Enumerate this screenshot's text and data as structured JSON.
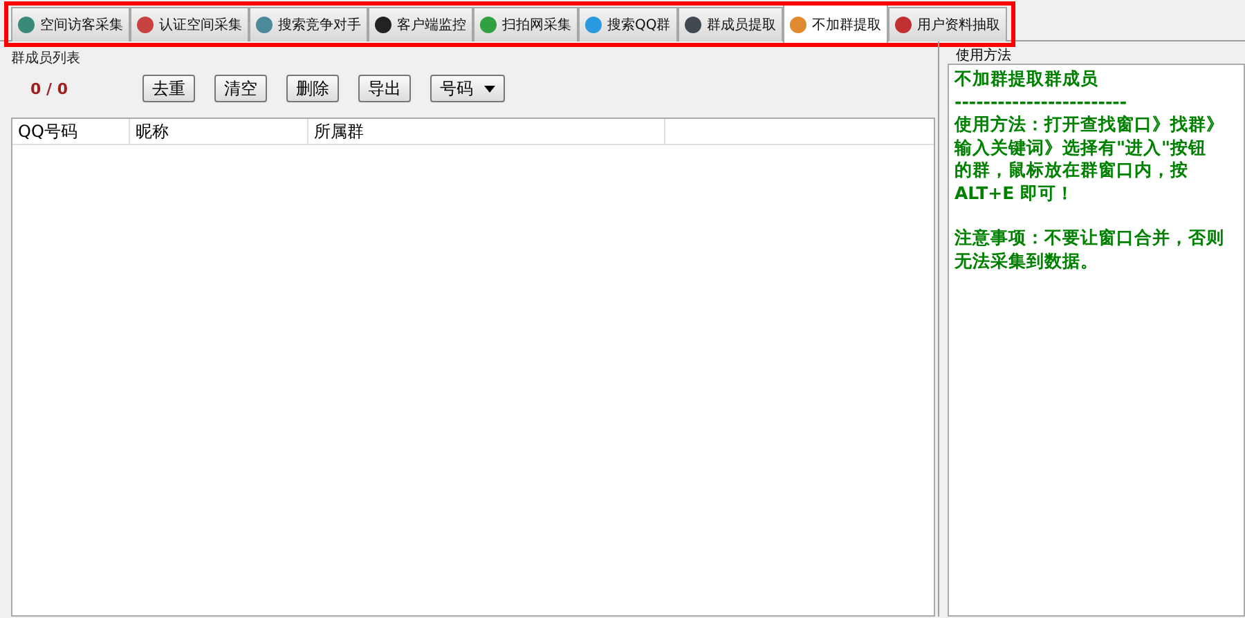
{
  "tabs": [
    {
      "label": "空间访客采集",
      "selected": false,
      "color": "#3a8a7a"
    },
    {
      "label": "认证空间采集",
      "selected": false,
      "color": "#c84040"
    },
    {
      "label": "搜索竞争对手",
      "selected": false,
      "color": "#4a8a9a"
    },
    {
      "label": "客户端监控",
      "selected": false,
      "color": "#222222"
    },
    {
      "label": "扫拍网采集",
      "selected": false,
      "color": "#30a040"
    },
    {
      "label": "搜索QQ群",
      "selected": false,
      "color": "#2a9ae0"
    },
    {
      "label": "群成员提取",
      "selected": false,
      "color": "#404850"
    },
    {
      "label": "不加群提取",
      "selected": true,
      "color": "#e08a30"
    },
    {
      "label": "用户资料抽取",
      "selected": false,
      "color": "#c03030"
    }
  ],
  "member_list": {
    "title": "群成员列表",
    "count": "0 / 0",
    "buttons": [
      "去重",
      "清空",
      "删除",
      "导出"
    ],
    "dropdown": {
      "value": "号码"
    },
    "table": {
      "columns": [
        "QQ号码",
        "昵称",
        "所属群"
      ]
    }
  },
  "help": {
    "title": "使用方法",
    "lines": [
      {
        "kind": "text",
        "text": "不加群提取群成员"
      },
      {
        "kind": "text",
        "text": "------------------------"
      },
      {
        "kind": "text",
        "text": "使用方法：打开查找窗口》找群》输入关键词》选择有\"进入\"按钮的群，鼠标放在群窗口内，按 ALT+E 即可！"
      },
      {
        "kind": "blank"
      },
      {
        "kind": "text",
        "text": "注意事项：不要让窗口合并，否则无法采集到数据。"
      }
    ]
  }
}
